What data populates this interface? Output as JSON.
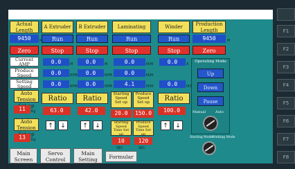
{
  "right_keys": [
    "",
    "F1",
    "F2",
    "F3",
    "F4",
    "F5",
    "F6",
    "F7",
    "F8"
  ],
  "columns": {
    "actual_length": {
      "header": "Actual Length",
      "value": "9450",
      "unit": "M",
      "zero": "Zero"
    },
    "a_extruder": {
      "header": "A Extruder",
      "run": "Run",
      "stop": "Stop",
      "v1": "0.0",
      "v2": "0.0",
      "v3": "0.0",
      "u1": "M",
      "u2": "RPM",
      "u3": "RPM",
      "ratio": "Ratio",
      "ratio_val": "63.0"
    },
    "b_extruder": {
      "header": "B Extruder",
      "run": "Run",
      "stop": "Stop",
      "v1": "0.0",
      "v2": "0.0",
      "v3": "0.0",
      "u1": "M",
      "u2": "RPM",
      "u3": "RPM",
      "ratio": "Ratio",
      "ratio_val": "42.0"
    },
    "laminating": {
      "header": "Laminating",
      "run": "Run",
      "stop": "Stop",
      "v1": "0.0",
      "v2": "0.0",
      "v3": "4.1",
      "u1": "M/M",
      "u2": "M/M",
      "u3": "M/M",
      "start_speed_hdr": "Starting Speed Set up",
      "produce_speed_hdr": "Produce Speed Set up",
      "start_speed_val": "20.0",
      "produce_speed_val": "150.0",
      "start_time_hdr": "Starting Speed Time Set up",
      "produce_time_hdr": "Produce Speed Time Set up",
      "start_time_val": "10",
      "produce_time_val": "120",
      "u_time1": "SEC",
      "u_time2": "SEC"
    },
    "winder": {
      "header": "Winder",
      "run": "Run",
      "stop": "Stop",
      "v1": "0.0",
      "v3": "0.0",
      "u1": "A",
      "u3": "M/M",
      "ratio": "Ratio",
      "ratio_val": "100.0"
    },
    "production_length": {
      "header": "Production Length",
      "value": "9450",
      "unit": "M",
      "zero": "Zero"
    }
  },
  "left_labels": {
    "current": "Current AMP",
    "produce": "Produce Speed",
    "setting": "Setting Speed"
  },
  "auto_tension": {
    "header": "Auto Tension Set up",
    "value": "11",
    "unit": "Kg"
  },
  "auto_tension2": {
    "header": "Auto Tension Set up",
    "value": "13",
    "unit": "Kg"
  },
  "operating_mode": {
    "title": "Operating Mode",
    "up": "Up",
    "down": "Down",
    "pause": "Pause",
    "manual": "Manual",
    "auto": "Auto",
    "starting_mode": "Starting Mode",
    "working_mode": "Working Mode"
  },
  "arrows": {
    "up": "↑",
    "down": "↓"
  },
  "tabs": [
    "Main Screen",
    "Servo Control",
    "Main Setting",
    "Formular"
  ]
}
